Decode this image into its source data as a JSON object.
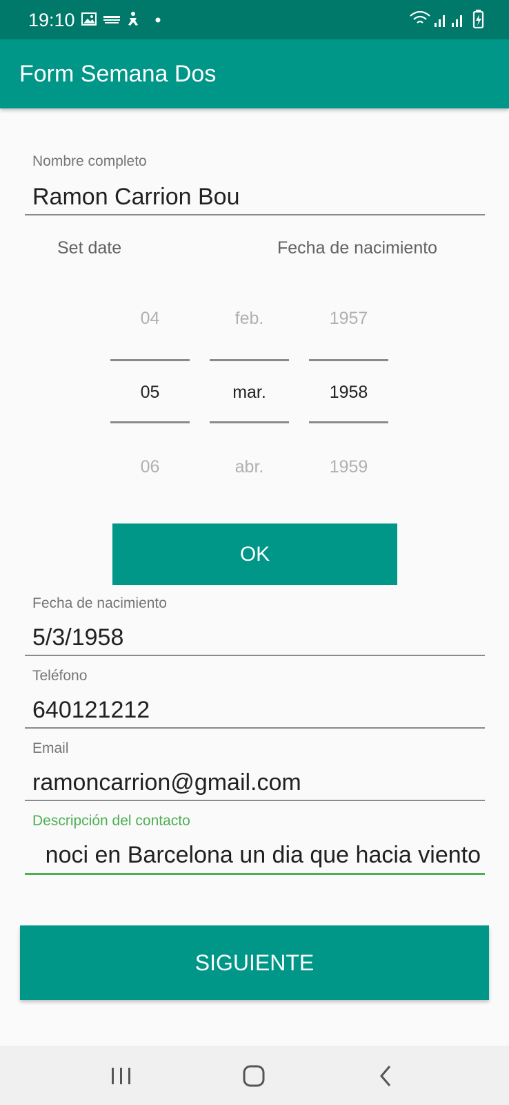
{
  "status_bar": {
    "time": "19:10",
    "left_icons": [
      "image-icon",
      "radio-app-icon",
      "accessibility-icon",
      "dot-icon"
    ],
    "right_icons": [
      "wifi-icon",
      "signal-icon",
      "signal-icon",
      "battery-charging-icon"
    ]
  },
  "app_bar": {
    "title": "Form Semana Dos"
  },
  "form": {
    "name": {
      "label": "Nombre completo",
      "value": "Ramon Carrion Bou"
    },
    "date_picker": {
      "title_left": "Set date",
      "title_right": "Fecha de nacimiento",
      "day": {
        "prev": "04",
        "selected": "05",
        "next": "06"
      },
      "month": {
        "prev": "feb.",
        "selected": "mar.",
        "next": "abr."
      },
      "year": {
        "prev": "1957",
        "selected": "1958",
        "next": "1959"
      },
      "ok_label": "OK"
    },
    "birth_date": {
      "label": "Fecha de nacimiento",
      "value": "5/3/1958"
    },
    "phone": {
      "label": "Teléfono",
      "value": "640121212"
    },
    "email": {
      "label": "Email",
      "value": "ramoncarrion@gmail.com"
    },
    "description": {
      "label": "Descripción del contacto",
      "value": "noci en Barcelona un dia que hacia viento"
    },
    "next_label": "SIGUIENTE"
  },
  "colors": {
    "status_bar": "#00796b",
    "primary": "#009688",
    "focus": "#4caf50"
  }
}
